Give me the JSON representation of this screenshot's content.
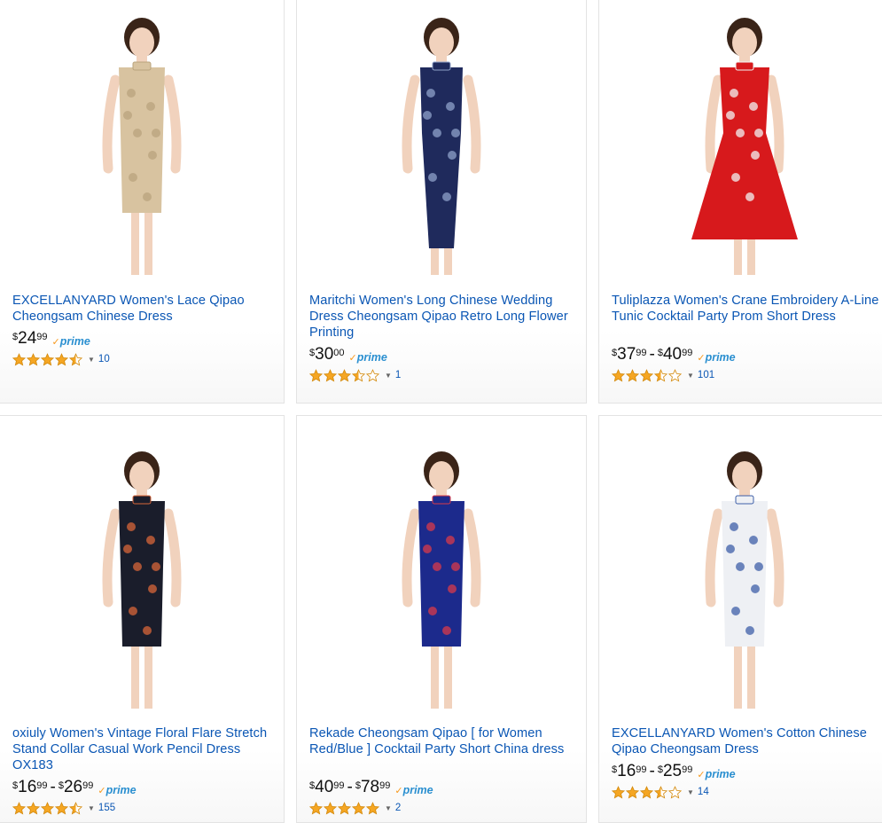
{
  "products": [
    {
      "title": "EXCELLANYARD Women's Lace Qipao Cheongsam Chinese Dress",
      "price": {
        "currency": "$",
        "whole": "24",
        "fraction": "99"
      },
      "prime": "prime",
      "rating": 4.5,
      "review_count": "10",
      "image_alt": "Woman in beige lace cheongsam",
      "colors": {
        "dress": "#d8c3a0",
        "accent": "#b9a37d"
      }
    },
    {
      "title": "Maritchi Women's Long Chinese Wedding Dress Cheongsam Qipao Retro Long Flower Printing",
      "price": {
        "currency": "$",
        "whole": "30",
        "fraction": "00"
      },
      "prime": "prime",
      "rating": 3.5,
      "review_count": "1",
      "image_alt": "Woman in long navy floral qipao",
      "colors": {
        "dress": "#1f2a5c",
        "accent": "#8fa2c9"
      }
    },
    {
      "title": "Tuliplazza Women's Crane Embroidery A-Line Tunic Cocktail Party Prom Short Dress",
      "price": {
        "currency": "$",
        "whole": "37",
        "fraction": "99",
        "to_whole": "40",
        "to_fraction": "99"
      },
      "prime": "prime",
      "rating": 3.5,
      "review_count": "101",
      "image_alt": "Woman in red crane embroidered dress",
      "colors": {
        "dress": "#d7191c",
        "accent": "#f2f2f2"
      }
    },
    {
      "title": "oxiuly Women's Vintage Floral Flare Stretch Stand Collar Casual Work Pencil Dress OX183",
      "price": {
        "currency": "$",
        "whole": "16",
        "fraction": "99",
        "to_whole": "26",
        "to_fraction": "99"
      },
      "prime": "prime",
      "rating": 4.5,
      "review_count": "155",
      "image_alt": "Woman in black floral pencil dress",
      "colors": {
        "dress": "#1a1d2b",
        "accent": "#d8663a"
      }
    },
    {
      "title": "Rekade Cheongsam Qipao [ for Women Red/Blue ] Cocktail Party Short China dress",
      "price": {
        "currency": "$",
        "whole": "40",
        "fraction": "99",
        "to_whole": "78",
        "to_fraction": "99"
      },
      "prime": "prime",
      "rating": 5,
      "review_count": "2",
      "image_alt": "Woman in blue velvet qipao with peony",
      "colors": {
        "dress": "#1c2a8c",
        "accent": "#d83a4a"
      }
    },
    {
      "title": "EXCELLANYARD Women's Cotton Chinese Qipao Cheongsam Dress",
      "price": {
        "currency": "$",
        "whole": "16",
        "fraction": "99",
        "to_whole": "25",
        "to_fraction": "99"
      },
      "prime": "prime",
      "rating": 3.5,
      "review_count": "14",
      "image_alt": "Woman in white blue-floral cheongsam",
      "colors": {
        "dress": "#eef0f4",
        "accent": "#3e5fa8"
      }
    }
  ]
}
